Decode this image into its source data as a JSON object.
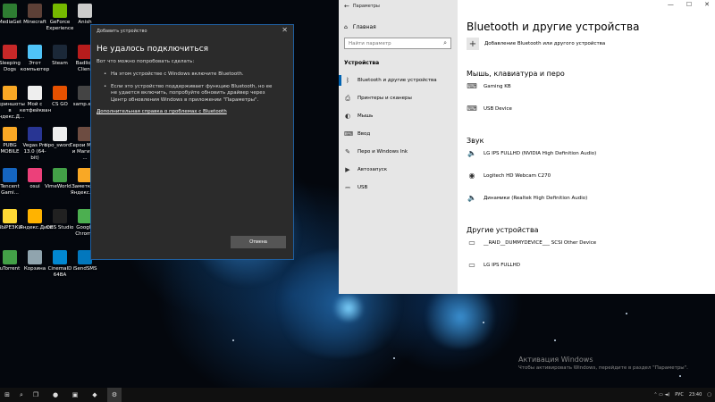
{
  "desktop_icons": [
    {
      "label": "MediaGet",
      "color": "#2e7d32"
    },
    {
      "label": "Minecraft",
      "color": "#5d4037"
    },
    {
      "label": "GeForce Experience",
      "color": "#76b900"
    },
    {
      "label": "Anish",
      "color": "#cccccc"
    },
    {
      "label": "Sleeping Dogs",
      "color": "#c62828"
    },
    {
      "label": "Этот компьютер",
      "color": "#4fc3f7"
    },
    {
      "label": "Steam",
      "color": "#1b2838"
    },
    {
      "label": "Badlion Client",
      "color": "#b71c1c"
    },
    {
      "label": "Скриншоты в Яндекс.Д...",
      "color": "#f9a825"
    },
    {
      "label": "Мой с кетфейкван",
      "color": "#eeeeee"
    },
    {
      "label": "CS GO",
      "color": "#e65100"
    },
    {
      "label": "samp.exe",
      "color": "#444444"
    },
    {
      "label": "PUBG MOBILE",
      "color": "#f9a825"
    },
    {
      "label": "Vegas Pro 13.0 (64-bit)",
      "color": "#283593"
    },
    {
      "label": "tipo_sword...",
      "color": "#eeeeee"
    },
    {
      "label": "Герои Меча и Магии 3 ...",
      "color": "#6d4c41"
    },
    {
      "label": "Tencent Gami...",
      "color": "#1565c0"
    },
    {
      "label": "osui",
      "color": "#ec407a"
    },
    {
      "label": "VimeWorld...",
      "color": "#43a047"
    },
    {
      "label": "Заметки в Яндекс.Д...",
      "color": "#f9a825"
    },
    {
      "label": "ВЫРЕЗКИ",
      "color": "#fdd835"
    },
    {
      "label": "Яндекс.Диск",
      "color": "#ffb300"
    },
    {
      "label": "OBS Studio",
      "color": "#212121"
    },
    {
      "label": "Google Chrome",
      "color": "#4caf50"
    },
    {
      "label": "uTorrent",
      "color": "#43a047"
    },
    {
      "label": "Корзина",
      "color": "#90a4ae"
    },
    {
      "label": "CinemaID 64BA",
      "color": "#0288d1"
    },
    {
      "label": "iSendSMS",
      "color": "#0277bd"
    }
  ],
  "dialog": {
    "title": "Добавить устройство",
    "heading": "Не удалось подключиться",
    "intro": "Вот что можно попробовать сделать:",
    "bullets": [
      "На этом устройстве с Windows включите Bluetooth.",
      "Если это устройство поддерживает функцию Bluetooth, но ее не удается включить, попробуйте обновить драйвер через Центр обновления Windows в приложении \"Параметры\"."
    ],
    "help_link": "Дополнительная справка о проблемах с Bluetooth",
    "cancel_label": "Отмена",
    "close_glyph": "✕"
  },
  "settings": {
    "window_title": "Параметры",
    "controls": [
      "—",
      "☐",
      "✕"
    ],
    "sidebar": {
      "home_label": "Главная",
      "search_placeholder": "Найти параметр",
      "section_label": "Устройства",
      "items": [
        {
          "label": "Bluetooth и другие устройства",
          "icon": "bluetooth-icon",
          "glyph": "ᛒ",
          "active": true
        },
        {
          "label": "Принтеры и сканеры",
          "icon": "printer-icon",
          "glyph": "⎙",
          "active": false
        },
        {
          "label": "Мышь",
          "icon": "mouse-icon",
          "glyph": "◐",
          "active": false
        },
        {
          "label": "Ввод",
          "icon": "keyboard-icon",
          "glyph": "⌨",
          "active": false
        },
        {
          "label": "Перо и Windows Ink",
          "icon": "pen-icon",
          "glyph": "✎",
          "active": false
        },
        {
          "label": "Автозапуск",
          "icon": "autoplay-icon",
          "glyph": "▶",
          "active": false
        },
        {
          "label": "USB",
          "icon": "usb-icon",
          "glyph": "⎓",
          "active": false
        }
      ]
    },
    "main": {
      "title": "Bluetooth и другие устройства",
      "add_label": "Добавление Bluetooth или другого устройства",
      "sections": [
        {
          "title": "Мышь, клавиатура и перо",
          "devices": [
            {
              "name": "Gaming KB",
              "icon": "keyboard-icon",
              "glyph": "⌨"
            },
            {
              "name": "USB Device",
              "icon": "keyboard-icon",
              "glyph": "⌨"
            }
          ]
        },
        {
          "title": "Звук",
          "devices": [
            {
              "name": "LG IPS FULLHD (NVIDIA High Definition Audio)",
              "icon": "speaker-icon",
              "glyph": "🔈"
            },
            {
              "name": "Logitech HD Webcam C270",
              "icon": "webcam-icon",
              "glyph": "◉"
            },
            {
              "name": "Динамики (Realtek High Definition Audio)",
              "icon": "speaker-icon",
              "glyph": "🔈"
            }
          ]
        },
        {
          "title": "Другие устройства",
          "devices": [
            {
              "name": "__RAID__DUMMYDEVICE___ SCSI Other Device",
              "icon": "device-icon",
              "glyph": "▭"
            },
            {
              "name": "LG IPS FULLHD",
              "icon": "monitor-icon",
              "glyph": "▭"
            }
          ]
        }
      ]
    }
  },
  "watermark": {
    "line1": "Активация Windows",
    "line2": "Чтобы активировать Windows, перейдите в раздел \"Параметры\"."
  },
  "taskbar": {
    "start_glyph": "⊞",
    "search_glyph": "⌕",
    "taskview_glyph": "❐",
    "apps": [
      {
        "glyph": "●",
        "name": "chrome-icon"
      },
      {
        "glyph": "▣",
        "name": "app-icon"
      },
      {
        "glyph": "◆",
        "name": "app-icon-2"
      },
      {
        "glyph": "⚙",
        "name": "settings-icon",
        "active": true
      }
    ],
    "lang": "РУС",
    "time": "23:40"
  }
}
